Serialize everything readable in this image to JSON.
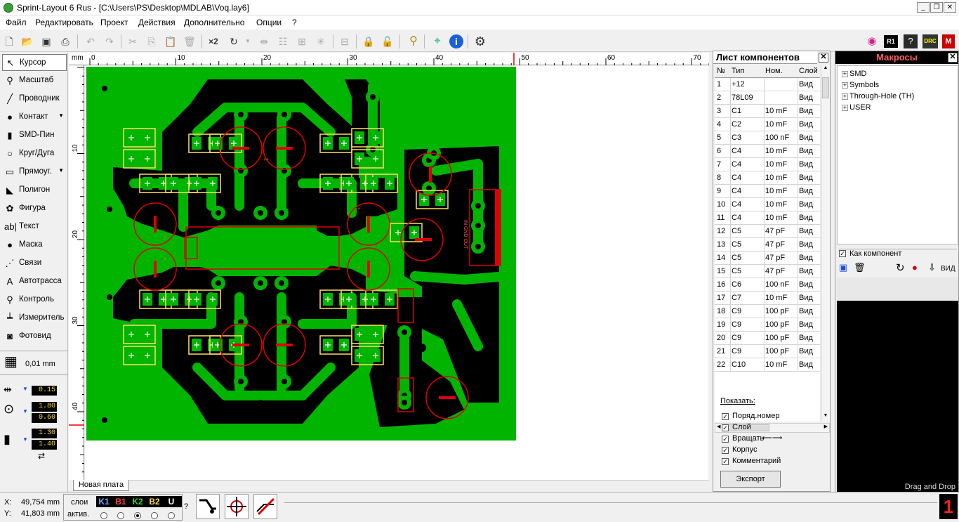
{
  "window": {
    "title": "Sprint-Layout 6 Rus - [C:\\Users\\PS\\Desktop\\MDLAB\\Voq.lay6]",
    "controls": [
      "_",
      "❐",
      "✕"
    ]
  },
  "menu": [
    "Файл",
    "Редактировать",
    "Проект",
    "Действия",
    "Дополнительно",
    "Опции",
    "?"
  ],
  "toolbar": {
    "x2_label": "×2",
    "icons": [
      "new-file-icon",
      "open-folder-icon",
      "save-icon",
      "print-icon",
      "undo-icon",
      "redo-icon",
      "cut-icon",
      "copy-icon",
      "paste-icon",
      "delete-icon",
      "rotate-icon",
      "mirror-icon",
      "align-icon",
      "group-icon",
      "ungroup-icon",
      "lock-icon",
      "unlock-icon",
      "zoom-icon",
      "connections-icon",
      "info-icon",
      "gear-icon",
      "photo-icon",
      "r1-icon",
      "help-icon",
      "drc-icon",
      "macro-icon"
    ]
  },
  "tools": [
    {
      "label": "Курсор",
      "icon": "↖",
      "active": true
    },
    {
      "label": "Масштаб",
      "icon": "⚲"
    },
    {
      "label": "Проводник",
      "icon": "╱"
    },
    {
      "label": "Контакт",
      "icon": "●",
      "dropdown": true
    },
    {
      "label": "SMD-Пин",
      "icon": "▮"
    },
    {
      "label": "Круг/Дуга",
      "icon": "○"
    },
    {
      "label": "Прямоуг.",
      "icon": "▭",
      "dropdown": true
    },
    {
      "label": "Полигон",
      "icon": "◣"
    },
    {
      "label": "Фигура",
      "icon": "✿"
    },
    {
      "label": "Текст",
      "icon": "ab|"
    },
    {
      "label": "Маска",
      "icon": "●"
    },
    {
      "label": "Связи",
      "icon": "⋰"
    },
    {
      "label": "Автотрасса",
      "icon": "A"
    },
    {
      "label": "Контроль",
      "icon": "⚲"
    },
    {
      "label": "Измеритель",
      "icon": "┷"
    },
    {
      "label": "Фотовид",
      "icon": "◙"
    }
  ],
  "grid": {
    "label": "0,01 mm"
  },
  "track_width": "0.15",
  "pad": {
    "outer": "1.80",
    "inner": "0.60"
  },
  "smd": {
    "w": "1.30",
    "h": "1.40"
  },
  "ruler": {
    "unit": "mm",
    "h_labels": [
      "0",
      "10",
      "20",
      "30",
      "40",
      "50",
      "60",
      "70"
    ],
    "v_labels": [
      "10",
      "20",
      "30",
      "40"
    ]
  },
  "board_tab": "Новая плата",
  "component_panel": {
    "title": "Лист компонентов",
    "columns": [
      "№",
      "Тип",
      "Ном.",
      "Слой"
    ],
    "rows": [
      [
        "1",
        "+12",
        "",
        "Вид"
      ],
      [
        "2",
        "78L09",
        "",
        "Вид"
      ],
      [
        "3",
        "C1",
        "10 mF",
        "Вид"
      ],
      [
        "4",
        "C2",
        "10 mF",
        "Вид"
      ],
      [
        "5",
        "C3",
        "100 nF",
        "Вид"
      ],
      [
        "6",
        "C4",
        "10 mF",
        "Вид"
      ],
      [
        "7",
        "C4",
        "10 mF",
        "Вид"
      ],
      [
        "8",
        "C4",
        "10 mF",
        "Вид"
      ],
      [
        "9",
        "C4",
        "10 mF",
        "Вид"
      ],
      [
        "10",
        "C4",
        "10 mF",
        "Вид"
      ],
      [
        "11",
        "C4",
        "10 mF",
        "Вид"
      ],
      [
        "12",
        "C5",
        "47 pF",
        "Вид"
      ],
      [
        "13",
        "C5",
        "47 pF",
        "Вид"
      ],
      [
        "14",
        "C5",
        "47 pF",
        "Вид"
      ],
      [
        "15",
        "C5",
        "47 pF",
        "Вид"
      ],
      [
        "16",
        "C6",
        "100 nF",
        "Вид"
      ],
      [
        "17",
        "C7",
        "10 mF",
        "Вид"
      ],
      [
        "18",
        "C9",
        "100 pF",
        "Вид"
      ],
      [
        "19",
        "C9",
        "100 pF",
        "Вид"
      ],
      [
        "20",
        "C9",
        "100 pF",
        "Вид"
      ],
      [
        "21",
        "C9",
        "100 pF",
        "Вид"
      ],
      [
        "22",
        "C10",
        "10 mF",
        "Вид"
      ]
    ],
    "show_label": "Показать:",
    "options": [
      "Поряд.номер",
      "Слой",
      "Вращать",
      "Корпус",
      "Комментарий"
    ],
    "export_label": "Экспорт"
  },
  "macro_panel": {
    "title": "Макросы",
    "tree": [
      "SMD",
      "Symbols",
      "Through-Hole (TH)",
      "USER"
    ],
    "as_component_label": "Как компонент",
    "view_label": "ВИД",
    "drag_drop": "Drag and Drop"
  },
  "status": {
    "x_label": "X:",
    "x_value": "49,754 mm",
    "y_label": "Y:",
    "y_value": "41,803 mm",
    "layers_label": "слои",
    "active_label": "актив.",
    "layers": [
      {
        "name": "K1",
        "color": "#6fa8ff"
      },
      {
        "name": "B1",
        "color": "#ff4040"
      },
      {
        "name": "K2",
        "color": "#33dd33"
      },
      {
        "name": "B2",
        "color": "#ffd84a"
      },
      {
        "name": "U",
        "color": "#ffffff"
      }
    ],
    "help": "?",
    "active_layer_number": "1"
  },
  "colors": {
    "board": "#00b400",
    "copper_bg": "#000000",
    "silk": "#ffe066",
    "outline": "#e00000"
  }
}
